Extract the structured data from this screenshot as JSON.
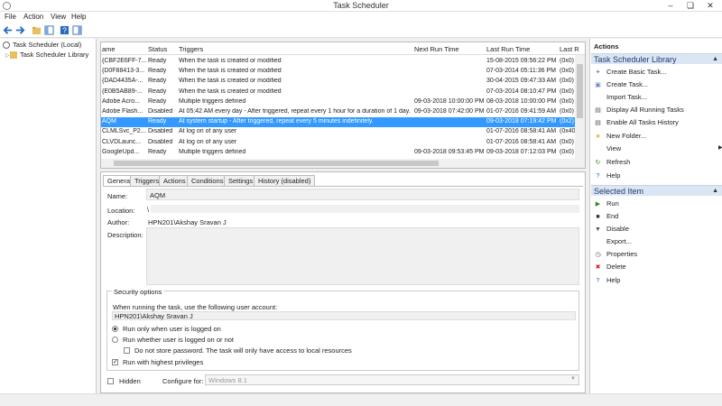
{
  "window": {
    "title": "Task Scheduler"
  },
  "menu": [
    "File",
    "Action",
    "View",
    "Help"
  ],
  "tree": {
    "root": "Task Scheduler (Local)",
    "child": "Task Scheduler Library"
  },
  "list": {
    "headers": [
      "ame",
      "Status",
      "Triggers",
      "Next Run Time",
      "Last Run Time",
      "Last R"
    ],
    "rows": [
      {
        "name": "{CBF2E6FF-7...",
        "status": "Ready",
        "trigger": "When the task is created or modified",
        "next": "",
        "last": "15-08-2015 09:56:22 PM",
        "result": "(0x0)"
      },
      {
        "name": "{D0F88413-3...",
        "status": "Ready",
        "trigger": "When the task is created or modified",
        "next": "",
        "last": "07-03-2014 05:11:36 PM",
        "result": "(0x0)"
      },
      {
        "name": "{DAD4435A-...",
        "status": "Ready",
        "trigger": "When the task is created or modified",
        "next": "",
        "last": "30-04-2015 09:47:33 AM",
        "result": "(0x0)"
      },
      {
        "name": "{E0B5AB89-...",
        "status": "Ready",
        "trigger": "When the task is created or modified",
        "next": "",
        "last": "07-03-2014 08:10:47 PM",
        "result": "(0x0)"
      },
      {
        "name": "Adobe Acro...",
        "status": "Ready",
        "trigger": "Multiple triggers defined",
        "next": "09-03-2018 10:00:00 PM",
        "last": "08-03-2018 10:00:00 PM",
        "result": "(0x0)"
      },
      {
        "name": "Adobe Flash...",
        "status": "Disabled",
        "trigger": "At 05:42 AM every day - After triggered, repeat every 1 hour for a duration of 1 day.",
        "next": "09-03-2018 07:42:00 PM",
        "last": "01-07-2016 09:41:59 AM",
        "result": "(0x0)"
      },
      {
        "name": "AQM",
        "status": "Ready",
        "trigger": "At system startup - After triggered, repeat every 5 minutes indefinitely.",
        "next": "",
        "last": "09-03-2018 07:19:42 PM",
        "result": "(0x2)",
        "selected": true
      },
      {
        "name": "CLMLSvc_P2...",
        "status": "Disabled",
        "trigger": "At log on of any user",
        "next": "",
        "last": "01-07-2016 08:58:41 AM",
        "result": "(0x400"
      },
      {
        "name": "CLVDLaunc...",
        "status": "Disabled",
        "trigger": "At log on of any user",
        "next": "",
        "last": "01-07-2016 08:58:41 AM",
        "result": "(0x0)"
      },
      {
        "name": "GoogleUpd...",
        "status": "Ready",
        "trigger": "Multiple triggers defined",
        "next": "09-03-2018 09:53:45 PM",
        "last": "09-03-2018 07:12:03 PM",
        "result": "(0x0)"
      }
    ]
  },
  "detail": {
    "tabs": [
      "General",
      "Triggers",
      "Actions",
      "Conditions",
      "Settings",
      "History (disabled)"
    ],
    "name_label": "Name:",
    "name_value": "AQM",
    "location_label": "Location:",
    "location_value": "\\",
    "author_label": "Author:",
    "author_value": "HPN201\\Akshay Sravan J",
    "description_label": "Description:",
    "security_title": "Security options",
    "account_prompt": "When running the task, use the following user account:",
    "account_value": "HPN201\\Akshay Sravan J",
    "radio1": "Run only when user is logged on",
    "radio2": "Run whether user is logged on or not",
    "check_nostore": "Do not store password.  The task will only have access to local resources",
    "check_highest": "Run with highest privileges",
    "hidden_label": "Hidden",
    "configure_label": "Configure for:",
    "configure_value": "Windows 8.1"
  },
  "actions": {
    "title": "Actions",
    "section1": "Task Scheduler Library",
    "items1": [
      "Create Basic Task...",
      "Create Task...",
      "Import Task...",
      "Display All Running Tasks",
      "Enable All Tasks History",
      "New Folder...",
      "View",
      "Refresh",
      "Help"
    ],
    "section2": "Selected Item",
    "items2": [
      "Run",
      "End",
      "Disable",
      "Export...",
      "Properties",
      "Delete",
      "Help"
    ]
  }
}
